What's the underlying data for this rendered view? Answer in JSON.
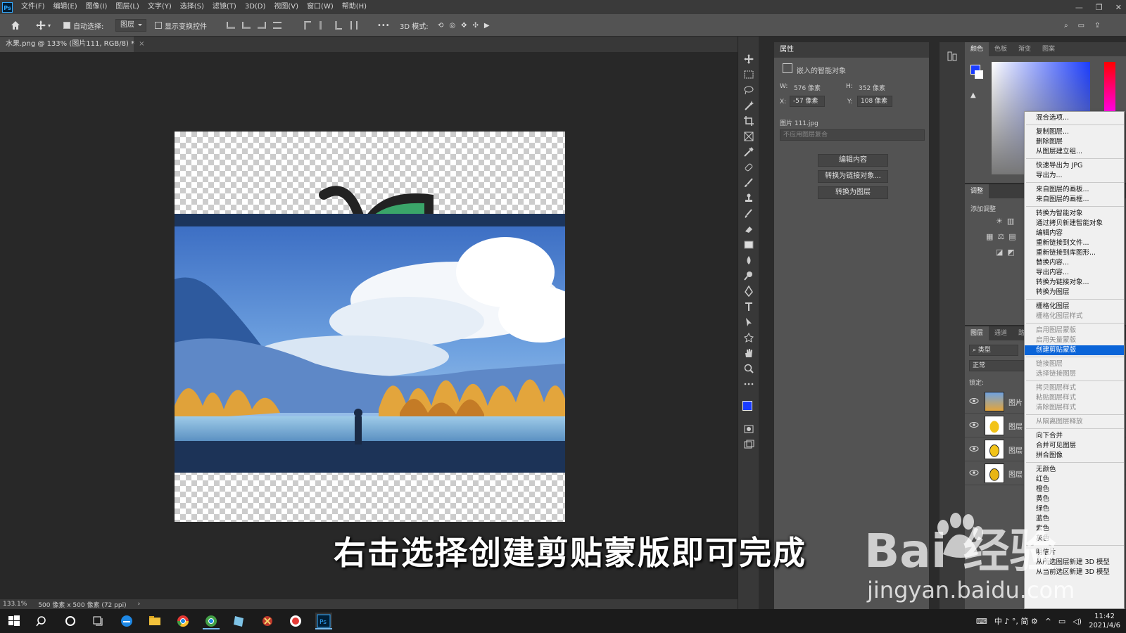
{
  "menubar": {
    "logo": "Ps",
    "items": [
      "文件(F)",
      "编辑(E)",
      "图像(I)",
      "图层(L)",
      "文字(Y)",
      "选择(S)",
      "滤镜(T)",
      "3D(D)",
      "视图(V)",
      "窗口(W)",
      "帮助(H)"
    ]
  },
  "options": {
    "auto_select_label": "自动选择:",
    "auto_select_value": "图层",
    "show_transform_label": "显示变换控件",
    "more": "•••",
    "mode_3d_label": "3D 模式:"
  },
  "document": {
    "tab_title": "水果.png @ 133% (图片111, RGB/8) *"
  },
  "status": {
    "zoom": "133.1%",
    "info": "500 像素 x 500 像素 (72 ppi)"
  },
  "properties": {
    "title": "属性",
    "object_type": "嵌入的智能对象",
    "w_label": "W:",
    "w_value": "576 像素",
    "h_label": "H:",
    "h_value": "352 像素",
    "x_label": "X:",
    "x_value": "-57 像素",
    "y_label": "Y:",
    "y_value": "108 像素",
    "source_file": "图片 111.jpg",
    "comp_placeholder": "不应用图层复合",
    "buttons": [
      "编辑内容",
      "转换为链接对象...",
      "转换为图层"
    ]
  },
  "color_panel": {
    "tabs": [
      "颜色",
      "色板",
      "渐变",
      "图案"
    ],
    "foreground": "#1a3cff"
  },
  "adjust_panel": {
    "tab": "调整",
    "label": "添加调整"
  },
  "layers_panel": {
    "tabs": [
      "图层",
      "通道",
      "路"
    ],
    "filter_label": "类型",
    "blend_mode": "正常",
    "lock_label": "锁定:",
    "layers": [
      "图片",
      "图层",
      "图层",
      "图层"
    ]
  },
  "context_menu": {
    "groups": [
      [
        {
          "t": "混合选项...",
          "d": false
        }
      ],
      [
        {
          "t": "复制图层...",
          "d": false
        },
        {
          "t": "删除图层",
          "d": false
        },
        {
          "t": "从图层建立组...",
          "d": false
        }
      ],
      [
        {
          "t": "快速导出为 JPG",
          "d": false
        },
        {
          "t": "导出为...",
          "d": false
        }
      ],
      [
        {
          "t": "来自图层的画板...",
          "d": false
        },
        {
          "t": "来自图层的画框...",
          "d": false
        }
      ],
      [
        {
          "t": "转换为智能对象",
          "d": false
        },
        {
          "t": "通过拷贝新建智能对象",
          "d": false
        },
        {
          "t": "编辑内容",
          "d": false
        },
        {
          "t": "重新链接到文件...",
          "d": false
        },
        {
          "t": "重新链接到库图形...",
          "d": false
        },
        {
          "t": "替换内容...",
          "d": false
        },
        {
          "t": "导出内容...",
          "d": false
        },
        {
          "t": "转换为链接对象...",
          "d": false
        },
        {
          "t": "转换为图层",
          "d": false
        }
      ],
      [
        {
          "t": "栅格化图层",
          "d": false
        },
        {
          "t": "栅格化图层样式",
          "d": true
        }
      ],
      [
        {
          "t": "启用图层蒙版",
          "d": true
        },
        {
          "t": "启用矢量蒙版",
          "d": true
        },
        {
          "t": "创建剪贴蒙版",
          "d": false,
          "hl": true
        }
      ],
      [
        {
          "t": "链接图层",
          "d": true
        },
        {
          "t": "选择链接图层",
          "d": true
        }
      ],
      [
        {
          "t": "拷贝图层样式",
          "d": true
        },
        {
          "t": "粘贴图层样式",
          "d": true
        },
        {
          "t": "清除图层样式",
          "d": true
        }
      ],
      [
        {
          "t": "从隔离图层释放",
          "d": true
        }
      ],
      [
        {
          "t": "向下合并",
          "d": false
        },
        {
          "t": "合并可见图层",
          "d": false
        },
        {
          "t": "拼合图像",
          "d": false
        }
      ],
      [
        {
          "t": "无颜色",
          "d": false
        },
        {
          "t": "红色",
          "d": false
        },
        {
          "t": "橙色",
          "d": false
        },
        {
          "t": "黄色",
          "d": false
        },
        {
          "t": "绿色",
          "d": false
        },
        {
          "t": "蓝色",
          "d": false
        },
        {
          "t": "紫色",
          "d": false
        },
        {
          "t": "灰色",
          "d": false
        }
      ],
      [
        {
          "t": "明信片",
          "d": false
        },
        {
          "t": "从所选图层新建 3D 模型",
          "d": false
        },
        {
          "t": "从当前选区新建 3D 模型",
          "d": false
        }
      ]
    ]
  },
  "subtitle": "右击选择创建剪贴蒙版即可完成",
  "watermark": {
    "logo": "Bai  经验",
    "url": "jingyan.baidu.com"
  },
  "taskbar": {
    "tray_text": "中 ♪ °, 简 ⚙",
    "time": "11:42",
    "date": "2021/4/6"
  }
}
